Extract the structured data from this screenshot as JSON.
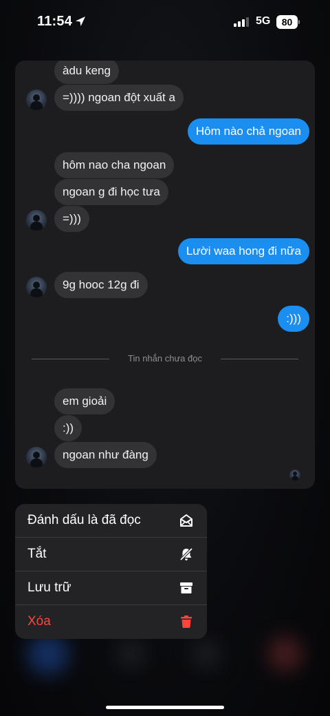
{
  "status_bar": {
    "time": "11:54",
    "network": "5G",
    "battery": "80"
  },
  "chat": {
    "messages": [
      {
        "side": "in",
        "text": "àdu keng"
      },
      {
        "side": "in",
        "text": "=)))) ngoan đột xuất a"
      },
      {
        "side": "out",
        "text": "Hôm nào chả ngoan"
      },
      {
        "side": "in",
        "text": "hôm nao cha ngoan"
      },
      {
        "side": "in",
        "text": "ngoan g đi học tưa"
      },
      {
        "side": "in",
        "text": "=)))"
      },
      {
        "side": "out",
        "text": "Lười waa hong đi nữa"
      },
      {
        "side": "in",
        "text": "9g hooc 12g đi"
      },
      {
        "side": "out",
        "text": ":)))"
      },
      {
        "side": "in",
        "text": "em gioải"
      },
      {
        "side": "in",
        "text": ":))"
      },
      {
        "side": "in",
        "text": "ngoan như đàng"
      }
    ],
    "unread_divider": "Tin nhắn chưa đọc"
  },
  "context_menu": {
    "items": [
      {
        "label": "Đánh dấu là đã đọc",
        "icon": "envelope-open-icon"
      },
      {
        "label": "Tắt",
        "icon": "bell-slash-icon"
      },
      {
        "label": "Lưu trữ",
        "icon": "archive-box-icon"
      },
      {
        "label": "Xóa",
        "icon": "trash-icon",
        "color": "#ff453a"
      }
    ]
  },
  "colors": {
    "outgoing_bubble": "#1b8ff1",
    "incoming_bubble": "#333336",
    "destructive": "#ff453a"
  }
}
